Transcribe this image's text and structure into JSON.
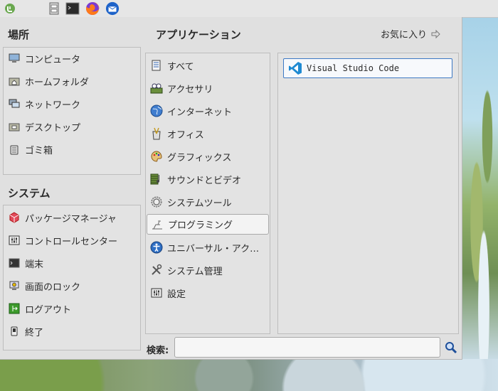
{
  "panel": {
    "icons": [
      "mint-menu-icon",
      "file-cabinet-icon",
      "terminal-icon",
      "firefox-icon",
      "thunderbird-icon"
    ]
  },
  "places": {
    "title": "場所",
    "items": [
      {
        "label": "コンピュータ",
        "icon": "computer-icon"
      },
      {
        "label": "ホームフォルダ",
        "icon": "home-folder-icon"
      },
      {
        "label": "ネットワーク",
        "icon": "network-icon"
      },
      {
        "label": "デスクトップ",
        "icon": "desktop-folder-icon"
      },
      {
        "label": "ゴミ箱",
        "icon": "trash-icon"
      }
    ]
  },
  "system": {
    "title": "システム",
    "items": [
      {
        "label": "パッケージマネージャ",
        "icon": "package-manager-icon"
      },
      {
        "label": "コントロールセンター",
        "icon": "control-center-icon"
      },
      {
        "label": "端末",
        "icon": "terminal-icon"
      },
      {
        "label": "画面のロック",
        "icon": "lock-screen-icon"
      },
      {
        "label": "ログアウト",
        "icon": "logout-icon"
      },
      {
        "label": "終了",
        "icon": "shutdown-icon"
      }
    ]
  },
  "applications": {
    "title": "アプリケーション",
    "favorites_label": "お気に入り",
    "categories": [
      {
        "label": "すべて",
        "icon": "all-apps-icon"
      },
      {
        "label": "アクセサリ",
        "icon": "accessories-icon"
      },
      {
        "label": "インターネット",
        "icon": "internet-globe-icon"
      },
      {
        "label": "オフィス",
        "icon": "office-icon"
      },
      {
        "label": "グラフィックス",
        "icon": "graphics-palette-icon"
      },
      {
        "label": "サウンドとビデオ",
        "icon": "sound-video-icon"
      },
      {
        "label": "システムツール",
        "icon": "system-tools-gear-icon"
      },
      {
        "label": "プログラミング",
        "icon": "programming-icon",
        "selected": true
      },
      {
        "label": "ユニバーサル・アク…",
        "icon": "accessibility-icon"
      },
      {
        "label": "システム管理",
        "icon": "admin-tools-icon"
      },
      {
        "label": "設定",
        "icon": "settings-icon"
      }
    ],
    "apps": [
      {
        "label": "Visual Studio Code",
        "icon": "vscode-icon"
      }
    ]
  },
  "search": {
    "label": "検索:",
    "value": "",
    "placeholder": ""
  },
  "colors": {
    "selection_border": "#3d79c4",
    "menu_bg": "#e0e0e0"
  }
}
